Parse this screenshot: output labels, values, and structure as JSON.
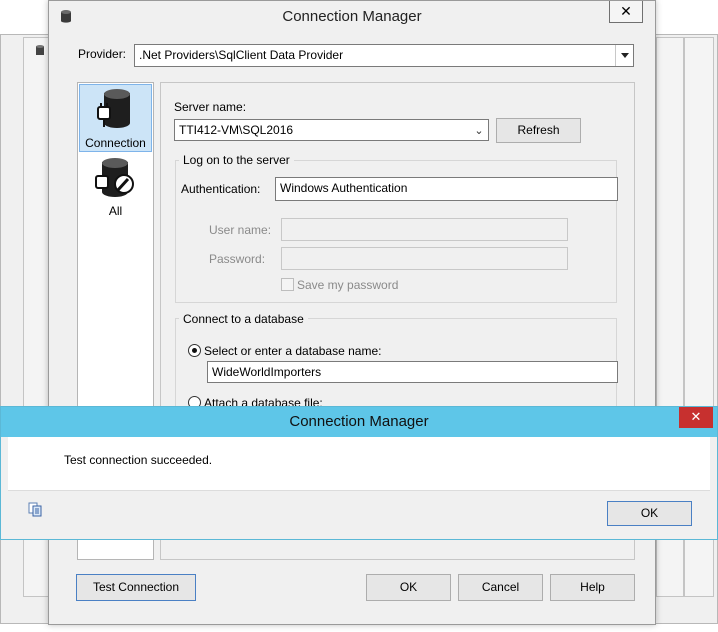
{
  "main_dialog": {
    "title": "Connection Manager",
    "close_label": "✕",
    "provider_label": "Provider:",
    "provider_value": ".Net Providers\\SqlClient Data Provider"
  },
  "sidebar": {
    "items": [
      {
        "label": "Connection",
        "icon": "database-plug-icon",
        "selected": true
      },
      {
        "label": "All",
        "icon": "database-wrench-icon",
        "selected": false
      }
    ]
  },
  "connection": {
    "server_label": "Server name:",
    "server_value": "TTI412-VM\\SQL2016",
    "refresh_label": "Refresh",
    "logon_title": "Log on to the server",
    "auth_label": "Authentication:",
    "auth_value": "Windows Authentication",
    "username_label": "User name:",
    "username_value": "",
    "password_label": "Password:",
    "password_value": "",
    "save_password_label": "Save my password",
    "save_password_checked": false,
    "db_group_title": "Connect to a database",
    "select_db_label": "Select or enter a database name:",
    "db_value": "WideWorldImporters",
    "attach_file_label": "Attach a database file:"
  },
  "footer_buttons": {
    "test": "Test Connection",
    "ok": "OK",
    "cancel": "Cancel",
    "help": "Help"
  },
  "message_box": {
    "title": "Connection Manager",
    "close_label": "✕",
    "message": "Test connection succeeded.",
    "ok": "OK",
    "copy_icon": "copy-icon"
  },
  "colors": {
    "msg_title_bar": "#5ec6e8",
    "msg_close": "#c7302f",
    "selection": "#cce4f7"
  }
}
